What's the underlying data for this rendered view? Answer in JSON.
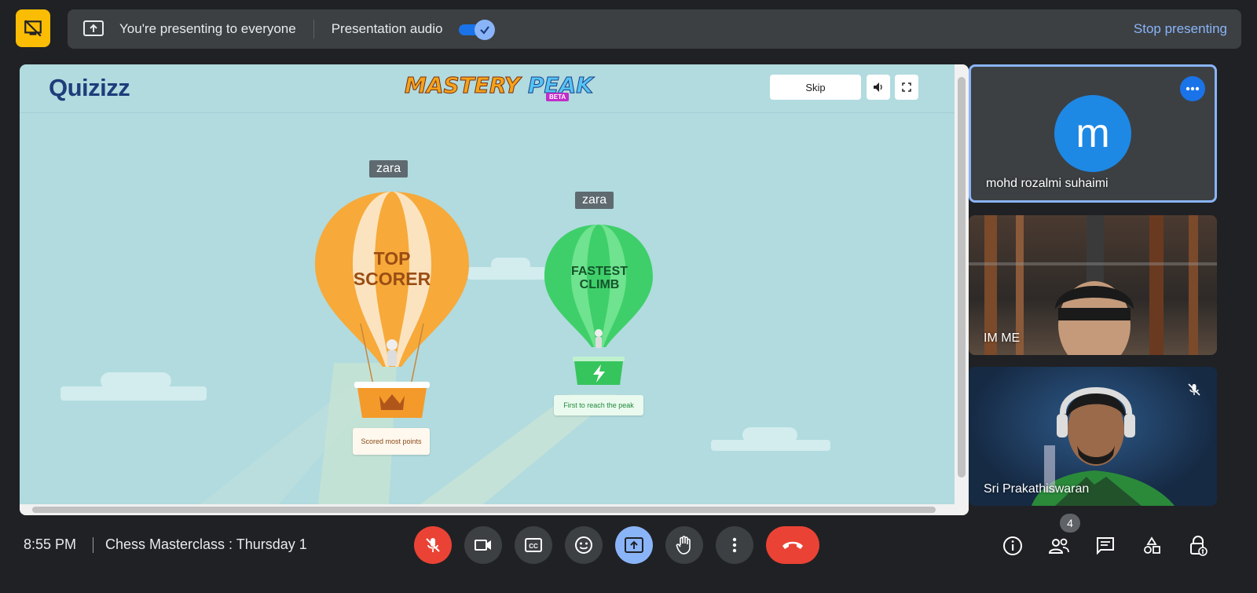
{
  "topbar": {
    "message": "You're presenting to everyone",
    "audio_label": "Presentation audio",
    "audio_enabled": true,
    "stop_label": "Stop presenting"
  },
  "stage": {
    "logo": "Quizizz",
    "game_title_part1": "MASTERY",
    "game_title_part2": "PEAK",
    "beta": "BETA",
    "skip_label": "Skip",
    "top_scorer": {
      "name": "zara",
      "line1": "TOP",
      "line2": "SCORER",
      "caption": "Scored most points"
    },
    "fastest_climb": {
      "name": "zara",
      "line1": "FASTEST",
      "line2": "CLIMB",
      "caption": "First to reach the peak"
    }
  },
  "participants": [
    {
      "initial": "m",
      "name": "mohd rozalmi suhaimi"
    },
    {
      "name": "IM ME"
    },
    {
      "name": "Sri Prakathiswaran"
    }
  ],
  "bottombar": {
    "time": "8:55 PM",
    "meeting_title": "Chess Masterclass : Thursday 1",
    "participant_count": "4"
  },
  "colors": {
    "accent": "#8ab4f8",
    "present_yellow": "#fbbc04",
    "danger": "#ea4335",
    "bar_bg": "#3c4043",
    "bg": "#202124"
  }
}
